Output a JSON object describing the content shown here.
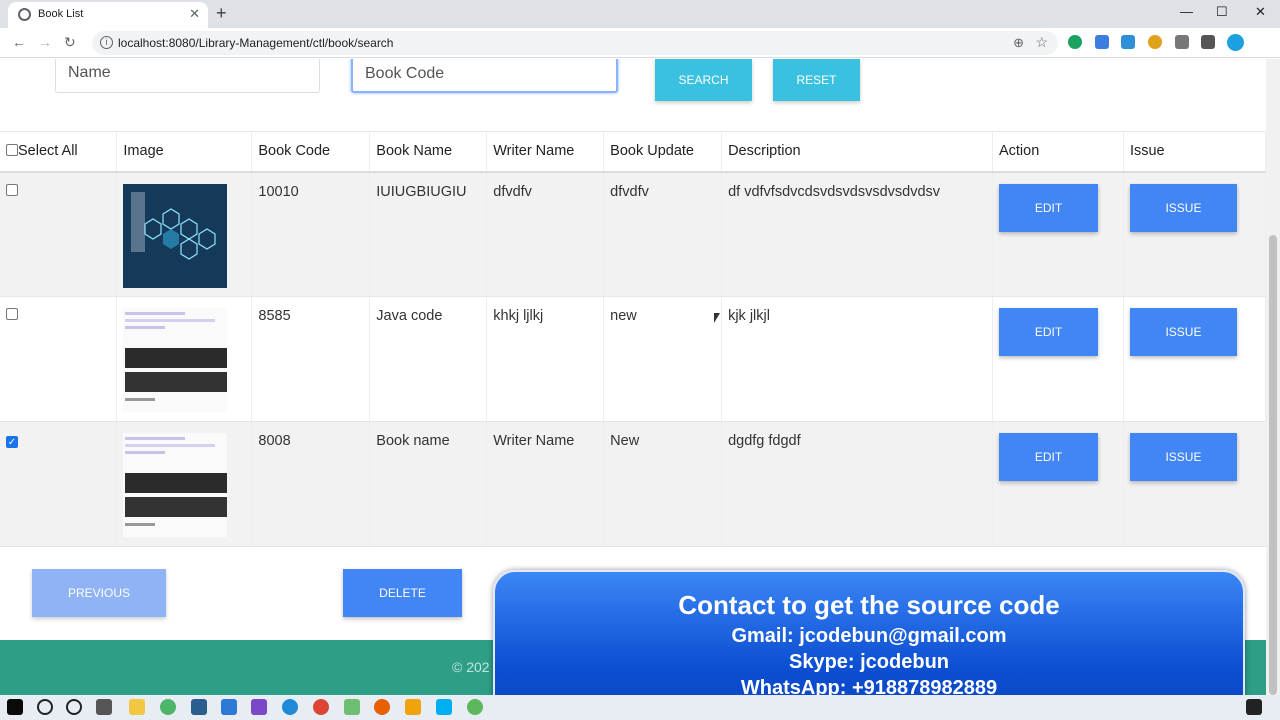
{
  "browser": {
    "tab_title": "Book List",
    "url": "localhost:8080/Library-Management/ctl/book/search",
    "info_glyph": "i",
    "new_tab": "+",
    "tab_close": "✕",
    "minimize": "—",
    "maximize": "☐",
    "close": "✕",
    "back": "←",
    "forward": "→",
    "reload": "↻",
    "zoom_glyph": "⊕",
    "star_glyph": "☆",
    "menu_glyph": "⋮"
  },
  "search": {
    "name_placeholder": "Name",
    "code_placeholder": "Book Code",
    "search_label": "SEARCH",
    "reset_label": "RESET"
  },
  "table": {
    "headers": [
      "Select All",
      "Image",
      "Book Code",
      "Book Name",
      "Writer Name",
      "Book Update",
      "Description",
      "Action",
      "Issue"
    ],
    "rows": [
      {
        "code": "10010",
        "name": "IUIUGBIUGIU",
        "writer": "dfvdfv",
        "update": "dfvdfv",
        "description": "df vdfvfsdvcdsvdsvdsvsdvsdvdsv",
        "checked": false,
        "edit": "EDIT",
        "issue": "ISSUE"
      },
      {
        "code": "8585",
        "name": "Java code",
        "writer": "khkj ljlkj",
        "update": "new",
        "description": "kjk jlkjl",
        "checked": false,
        "edit": "EDIT",
        "issue": "ISSUE"
      },
      {
        "code": "8008",
        "name": "Book name",
        "writer": "Writer Name",
        "update": "New",
        "description": "dgdfg fdgdf",
        "checked": true,
        "edit": "EDIT",
        "issue": "ISSUE"
      }
    ]
  },
  "pager": {
    "previous_label": "PREVIOUS",
    "delete_label": "DELETE"
  },
  "footer": {
    "copyright": "© 202"
  },
  "overlay": {
    "line1": "Contact to get the source code",
    "line2": "Gmail: jcodebun@gmail.com",
    "line3": "Skype: jcodebun",
    "line4": "WhatsApp: +918878982889"
  },
  "colors": {
    "accent_blue": "#4285f4",
    "cyan": "#3ac1e0",
    "footer_green": "#2e9e87"
  }
}
